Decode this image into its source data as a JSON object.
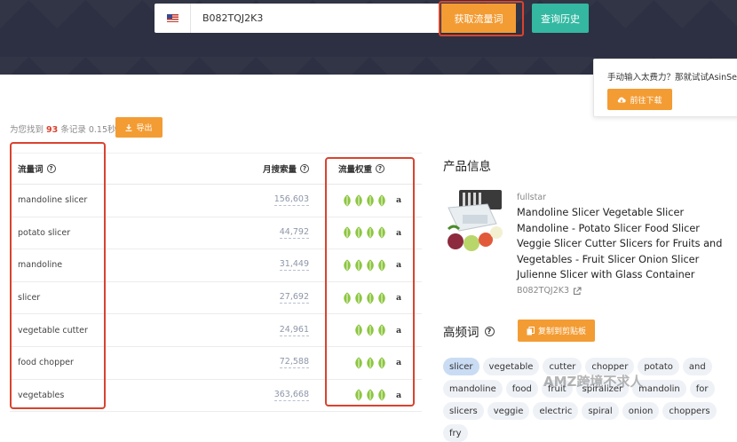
{
  "search": {
    "asin": "B082TQJ2K3",
    "get_button": "获取流量词",
    "history_button": "查询历史"
  },
  "tip": {
    "text": "手动输入太费力？那就试试AsinSee",
    "download_button": "前往下载"
  },
  "summary": {
    "prefix": "为您找到",
    "count": "93",
    "suffix": "条记录 0.15秒",
    "export_button": "导出"
  },
  "table": {
    "headers": {
      "keyword": "流量词",
      "volume": "月搜索量",
      "weight": "流量权重"
    },
    "rows": [
      {
        "keyword": "mandoline slicer",
        "volume": "156,603",
        "leaves": 4
      },
      {
        "keyword": "potato slicer",
        "volume": "44,792",
        "leaves": 4
      },
      {
        "keyword": "mandoline",
        "volume": "31,449",
        "leaves": 4
      },
      {
        "keyword": "slicer",
        "volume": "27,692",
        "leaves": 4
      },
      {
        "keyword": "vegetable cutter",
        "volume": "24,961",
        "leaves": 3
      },
      {
        "keyword": "food chopper",
        "volume": "72,588",
        "leaves": 3
      },
      {
        "keyword": "vegetables",
        "volume": "363,668",
        "leaves": 3
      }
    ],
    "amazon_mark": "a"
  },
  "product": {
    "section_title": "产品信息",
    "brand": "fullstar",
    "title": "Mandoline Slicer Vegetable Slicer Mandoline - Potato Slicer Food Slicer Veggie Slicer Cutter Slicers for Fruits and Vegetables - Fruit Slicer Onion Slicer Julienne Slicer with Glass Container",
    "asin": "B082TQJ2K3"
  },
  "high_freq": {
    "title": "高频词",
    "copy_button": "复制到剪贴板",
    "chips": [
      "slicer",
      "vegetable",
      "cutter",
      "chopper",
      "potato",
      "and",
      "mandoline",
      "food",
      "fruit",
      "spiralizer",
      "mandolin",
      "for",
      "slicers",
      "veggie",
      "electric",
      "spiral",
      "onion",
      "choppers",
      "fry"
    ]
  },
  "watermark": "AMZ跨境不求人",
  "colors": {
    "accent": "#f39c34",
    "teal": "#34b8a2",
    "highlight": "#d9432f",
    "leaf": "#8cc63f"
  }
}
